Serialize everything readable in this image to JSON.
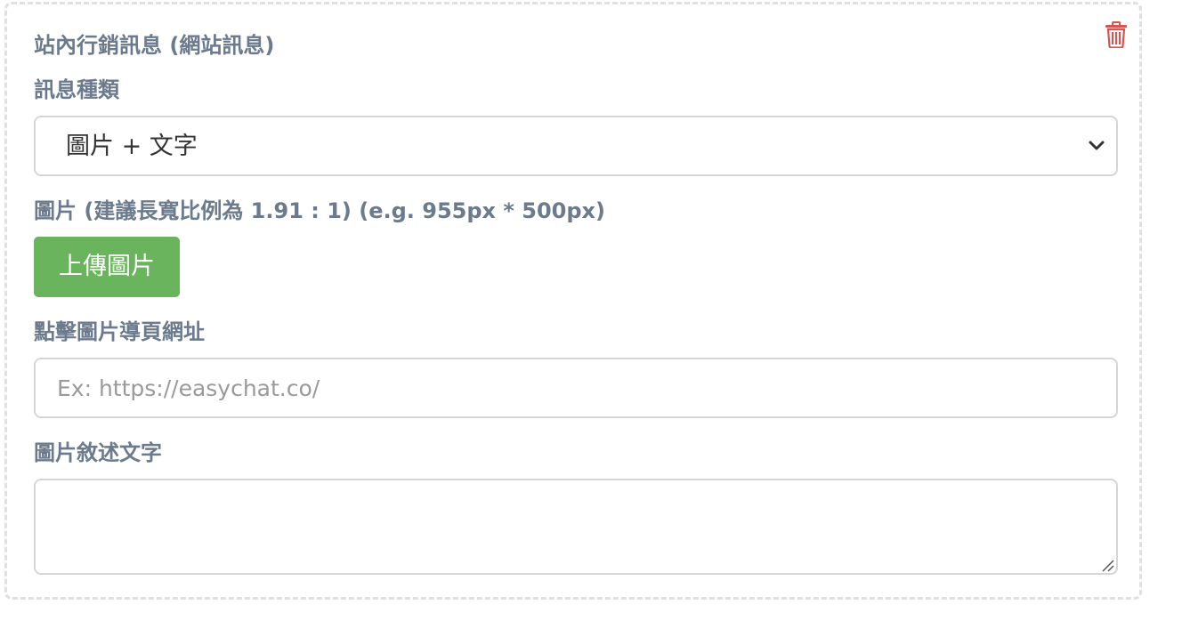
{
  "section": {
    "title": "站內行銷訊息 (網站訊息)"
  },
  "message_type": {
    "label": "訊息種類",
    "selected": "圖片 + 文字"
  },
  "image": {
    "label": "圖片 (建議長寬比例為 1.91 : 1) (e.g. 955px * 500px)",
    "upload_button": "上傳圖片"
  },
  "link": {
    "label": "點擊圖片導頁網址",
    "placeholder": "Ex: https://easychat.co/",
    "value": ""
  },
  "description": {
    "label": "圖片敘述文字",
    "value": ""
  },
  "icons": {
    "delete": "trash-icon",
    "select": "chevron-down-icon",
    "resize": "resize-handle-icon"
  },
  "colors": {
    "label": "#6b7a8c",
    "upload_button": "#6bb45e",
    "delete_icon": "#d9534f",
    "border": "#d6d6d6",
    "dashed_border": "#e0e0e0"
  }
}
